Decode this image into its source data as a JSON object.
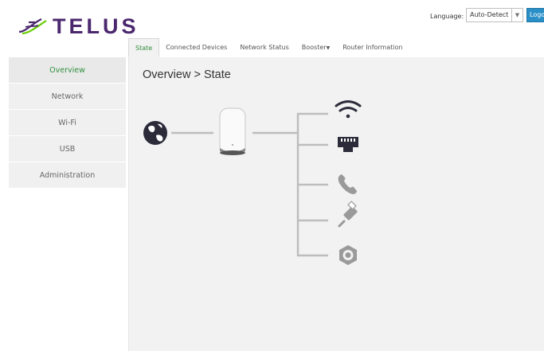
{
  "brand": {
    "name": "TELUS",
    "color": "#4b286d",
    "accent": "#2f8f3d"
  },
  "header": {
    "language_label": "Language:",
    "language_value": "Auto-Detect",
    "logout_label": "Logout"
  },
  "tabs": [
    {
      "label": "State",
      "active": true
    },
    {
      "label": "Connected Devices"
    },
    {
      "label": "Network Status"
    },
    {
      "label": "Booster",
      "has_dropdown": true
    },
    {
      "label": "Router Information"
    }
  ],
  "sidebar": {
    "items": [
      {
        "label": "Overview",
        "active": true
      },
      {
        "label": "Network"
      },
      {
        "label": "Wi-Fi"
      },
      {
        "label": "USB"
      },
      {
        "label": "Administration"
      }
    ]
  },
  "main": {
    "title": "Overview > State",
    "diagram": {
      "internet_icon": "globe-icon",
      "router_icon": "router-device-icon",
      "ports": [
        {
          "icon": "wifi-icon",
          "status": "active"
        },
        {
          "icon": "ethernet-icon",
          "status": "active"
        },
        {
          "icon": "phone-icon",
          "status": "inactive"
        },
        {
          "icon": "usb-icon",
          "status": "inactive"
        },
        {
          "icon": "coax-icon",
          "status": "inactive"
        }
      ],
      "colors": {
        "active": "#2b2b3a",
        "inactive": "#9a9a9a",
        "line": "#bdbdbd"
      }
    }
  }
}
